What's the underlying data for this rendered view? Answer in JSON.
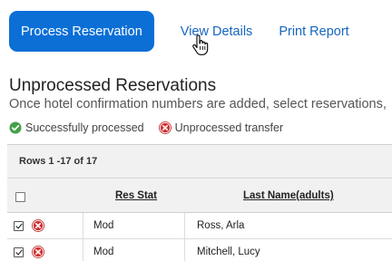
{
  "actions": {
    "process_label": "Process Reservation",
    "view_details_label": "View Details",
    "print_report_label": "Print Report"
  },
  "section": {
    "title": "Unprocessed Reservations",
    "subtitle": "Once hotel confirmation numbers are added, select reservations,"
  },
  "legend": {
    "success_label": "Successfully processed",
    "unprocessed_label": "Unprocessed transfer"
  },
  "grid": {
    "rows_info": "Rows 1 -17 of 17",
    "columns": {
      "res_stat": "Res Stat",
      "last_name": "Last Name(adults)"
    },
    "rows": [
      {
        "checked": true,
        "status_icon": "error-icon",
        "res_stat": "Mod",
        "last_name": "Ross, Arla"
      },
      {
        "checked": true,
        "status_icon": "error-icon",
        "res_stat": "Mod",
        "last_name": "Mitchell, Lucy"
      }
    ]
  },
  "colors": {
    "primary": "#0b6fd6",
    "link": "#1565c0",
    "success": "#43a047",
    "error": "#d32f2f"
  }
}
